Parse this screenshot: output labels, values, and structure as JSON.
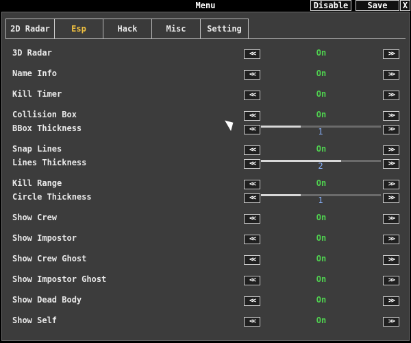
{
  "window": {
    "title": "Menu",
    "disable_label": "Disable",
    "save_label": "Save",
    "close_label": "X"
  },
  "tabs": [
    {
      "label": "2D Radar",
      "active": false
    },
    {
      "label": "Esp",
      "active": true
    },
    {
      "label": "Hack",
      "active": false
    },
    {
      "label": "Misc",
      "active": false
    },
    {
      "label": "Setting",
      "active": false
    }
  ],
  "arrows": {
    "left": "<<",
    "right": ">>"
  },
  "rows": [
    {
      "label": "3D Radar",
      "type": "toggle",
      "value": "On"
    },
    {
      "label": "Name Info",
      "type": "toggle",
      "value": "On"
    },
    {
      "label": "Kill Timer",
      "type": "toggle",
      "value": "On"
    },
    {
      "label": "Collision Box",
      "type": "toggle",
      "value": "On"
    },
    {
      "label": "BBox Thickness",
      "type": "slider",
      "value": "1",
      "fraction": 0.33
    },
    {
      "label": "Snap Lines",
      "type": "toggle",
      "value": "On"
    },
    {
      "label": "Lines Thickness",
      "type": "slider",
      "value": "2",
      "fraction": 0.67
    },
    {
      "label": "Kill Range",
      "type": "toggle",
      "value": "On"
    },
    {
      "label": "Circle Thickness",
      "type": "slider",
      "value": "1",
      "fraction": 0.33
    },
    {
      "label": "Show Crew",
      "type": "toggle",
      "value": "On"
    },
    {
      "label": "Show Impostor",
      "type": "toggle",
      "value": "On"
    },
    {
      "label": "Show Crew Ghost",
      "type": "toggle",
      "value": "On"
    },
    {
      "label": "Show Impostor Ghost",
      "type": "toggle",
      "value": "On"
    },
    {
      "label": "Show Dead Body",
      "type": "toggle",
      "value": "On"
    },
    {
      "label": "Show Self",
      "type": "toggle",
      "value": "On"
    }
  ]
}
